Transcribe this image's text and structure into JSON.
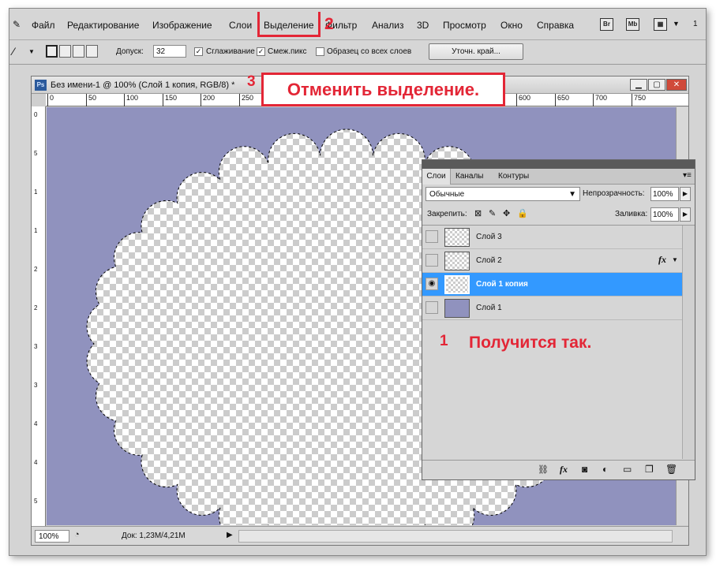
{
  "menu": {
    "items": [
      "Файл",
      "Редактирование",
      "Изображение",
      "Слои",
      "Выделение",
      "Фильтр",
      "Анализ",
      "3D",
      "Просмотр",
      "Окно",
      "Справка"
    ],
    "br": "Br",
    "mb": "Mb",
    "zoom_partial": "1"
  },
  "options": {
    "tolerance_label": "Допуск:",
    "tolerance_value": "32",
    "antialias_label": "Сглаживание",
    "antialias_checked": true,
    "contiguous_label": "Смеж.пикс",
    "contiguous_checked": true,
    "sample_all_label": "Образец со всех слоев",
    "sample_all_checked": false,
    "refine_edge_button": "Уточн. край..."
  },
  "document": {
    "title": "Без имени-1 @ 100% (Слой 1 копия, RGB/8) *",
    "ps_badge": "Ps",
    "ruler_top": [
      "0",
      "50",
      "100",
      "150",
      "200",
      "250",
      "600",
      "650",
      "700",
      "750"
    ],
    "ruler_left": [
      "0",
      "5",
      "1",
      "1",
      "2",
      "2",
      "3",
      "3",
      "4",
      "4",
      "5"
    ],
    "zoom": "100%",
    "doc_info": "Док: 1,23M/4,21M"
  },
  "layers_panel": {
    "tabs": [
      "Слои",
      "Каналы",
      "Контуры"
    ],
    "blend_mode": "Обычные",
    "opacity_label": "Непрозрачность:",
    "opacity_value": "100%",
    "lock_label": "Закрепить:",
    "fill_label": "Заливка:",
    "fill_value": "100%",
    "layers": [
      {
        "name": "Слой 3",
        "visible": false,
        "selected": false,
        "fx": false
      },
      {
        "name": "Слой 2",
        "visible": false,
        "selected": false,
        "fx": true
      },
      {
        "name": "Слой 1 копия",
        "visible": true,
        "selected": true,
        "fx": false
      },
      {
        "name": "Слой 1",
        "visible": false,
        "selected": false,
        "fx": false
      }
    ],
    "fx_label": "fx"
  },
  "annotations": {
    "n1": "1",
    "n1_text": "Получится так.",
    "n2": "2",
    "n3": "3",
    "n3_text": "Отменить выделение."
  },
  "colors": {
    "canvas": "#9092be",
    "accent": "#e32636",
    "selected_row": "#3399ff"
  }
}
